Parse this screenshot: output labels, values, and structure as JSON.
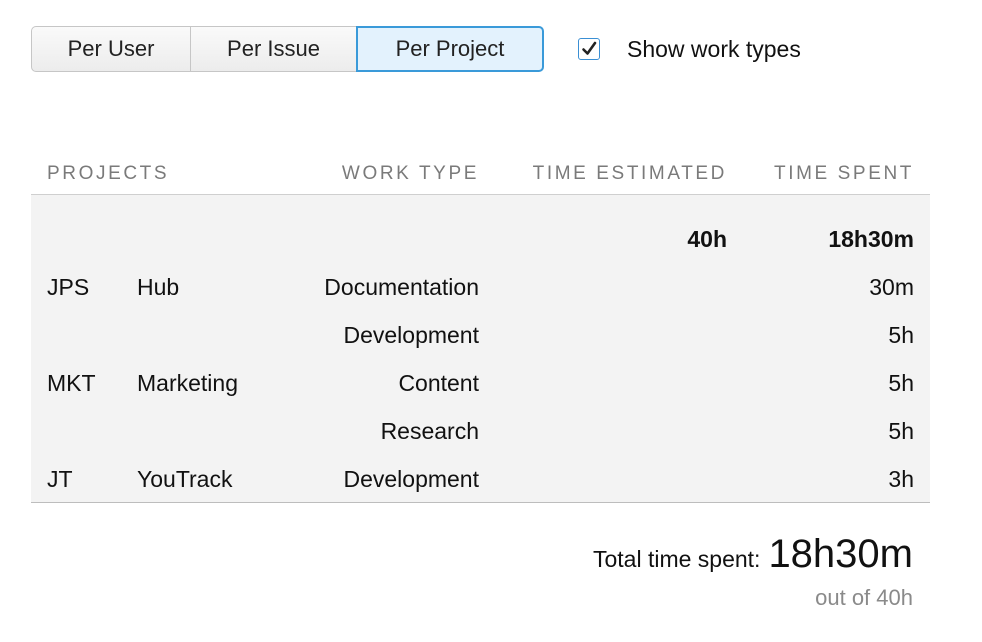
{
  "group_by": {
    "buttons": [
      "Per User",
      "Per Issue",
      "Per Project"
    ],
    "selected": "Per Project"
  },
  "show_work_types": {
    "label": "Show work types",
    "checked": true
  },
  "table": {
    "headers": {
      "projects": "PROJECTS",
      "work_type": "WORK TYPE",
      "time_estimated": "TIME ESTIMATED",
      "time_spent": "TIME SPENT"
    },
    "totals": {
      "time_estimated": "40h",
      "time_spent": "18h30m"
    },
    "rows": [
      {
        "key": "JPS",
        "name": "Hub",
        "work_type": "Documentation",
        "time_spent": "30m"
      },
      {
        "key": "",
        "name": "",
        "work_type": "Development",
        "time_spent": "5h"
      },
      {
        "key": "MKT",
        "name": "Marketing",
        "work_type": "Content",
        "time_spent": "5h"
      },
      {
        "key": "",
        "name": "",
        "work_type": "Research",
        "time_spent": "5h"
      },
      {
        "key": "JT",
        "name": "YouTrack",
        "work_type": "Development",
        "time_spent": "3h"
      }
    ]
  },
  "summary": {
    "label": "Total time spent:",
    "value": "18h30m",
    "out_of": "out of 40h"
  },
  "colors": {
    "accent": "#3a9ad9",
    "selected_bg": "#e3f2fd",
    "table_bg": "#f3f3f3"
  }
}
